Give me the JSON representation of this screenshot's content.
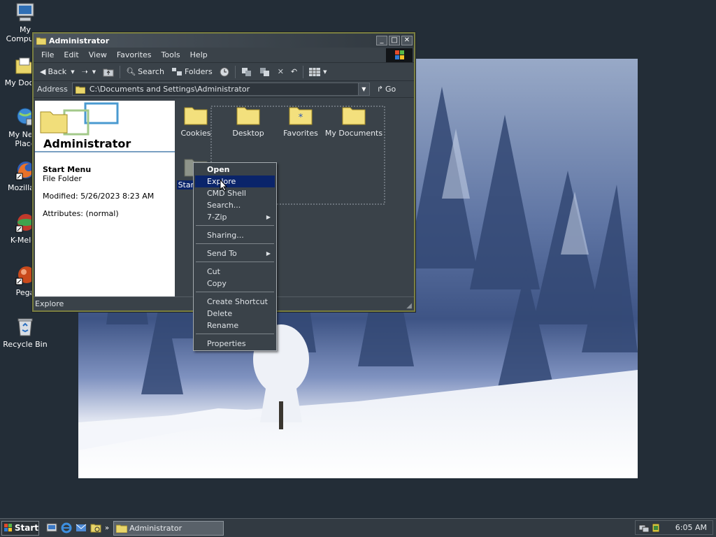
{
  "desktop": {
    "icons": [
      {
        "label": "My Computer"
      },
      {
        "label": "My Docum"
      },
      {
        "label": "My Netw"
      },
      {
        "label": "Place"
      },
      {
        "label": "Mozilla Fi"
      },
      {
        "label": "K-Melec"
      },
      {
        "label": "Pega"
      },
      {
        "label": "Recycle Bin"
      }
    ]
  },
  "window": {
    "title": "Administrator",
    "controls": {
      "minimize": "_",
      "maximize": "□",
      "close": "✕"
    },
    "menu": [
      "File",
      "Edit",
      "View",
      "Favorites",
      "Tools",
      "Help"
    ],
    "toolbar": {
      "back": "Back",
      "search": "Search",
      "folders": "Folders"
    },
    "address": {
      "label": "Address",
      "value": "C:\\Documents and Settings\\Administrator",
      "go": "Go"
    },
    "left_pane": {
      "title": "Administrator",
      "item_name": "Start Menu",
      "item_type": "File Folder",
      "modified": "Modified: 5/26/2023 8:23 AM",
      "attributes": "Attributes: (normal)"
    },
    "folders": [
      "Cookies",
      "Desktop",
      "Favorites",
      "My Documents",
      "Start"
    ],
    "status": "Explore"
  },
  "context_menu": {
    "items": [
      "Open",
      "Explore",
      "CMD Shell",
      "Search...",
      "7-Zip",
      "Sharing...",
      "Send To",
      "Cut",
      "Copy",
      "Create Shortcut",
      "Delete",
      "Rename",
      "Properties"
    ],
    "highlighted": "Explore"
  },
  "taskbar": {
    "start": "Start",
    "task": "Administrator",
    "clock": "6:05 AM"
  },
  "colors": {
    "highlight": "#0a246a",
    "window_bg": "#3a4249",
    "desktop": "#232d37"
  }
}
